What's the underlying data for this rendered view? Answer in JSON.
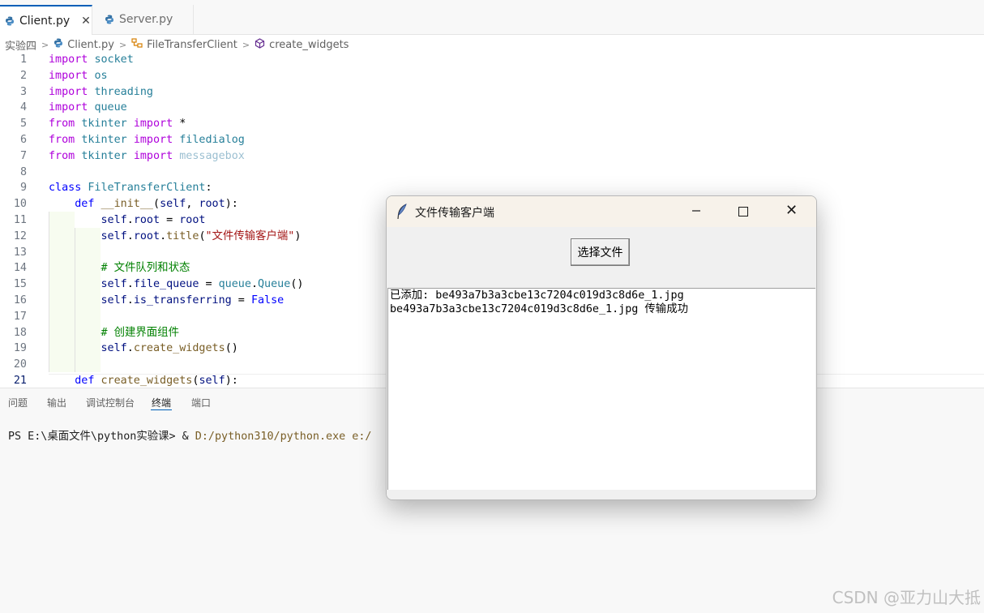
{
  "tabs": [
    {
      "label": "Client.py",
      "active": true,
      "close": "✕"
    },
    {
      "label": "Server.py",
      "active": false
    }
  ],
  "breadcrumb": [
    "实验四",
    "Client.py",
    "FileTransferClient",
    "create_widgets"
  ],
  "code": {
    "line_numbers": [
      "1",
      "2",
      "3",
      "4",
      "5",
      "6",
      "7",
      "8",
      "9",
      "10",
      "11",
      "12",
      "13",
      "14",
      "15",
      "16",
      "17",
      "18",
      "19",
      "20",
      "21"
    ],
    "lines": [
      [
        {
          "t": "import",
          "c": "kw"
        },
        {
          "t": " "
        },
        {
          "t": "socket",
          "c": "mod"
        }
      ],
      [
        {
          "t": "import",
          "c": "kw"
        },
        {
          "t": " "
        },
        {
          "t": "os",
          "c": "mod"
        }
      ],
      [
        {
          "t": "import",
          "c": "kw"
        },
        {
          "t": " "
        },
        {
          "t": "threading",
          "c": "mod"
        }
      ],
      [
        {
          "t": "import",
          "c": "kw"
        },
        {
          "t": " "
        },
        {
          "t": "queue",
          "c": "mod"
        }
      ],
      [
        {
          "t": "from",
          "c": "kw"
        },
        {
          "t": " "
        },
        {
          "t": "tkinter",
          "c": "mod"
        },
        {
          "t": " "
        },
        {
          "t": "import",
          "c": "kw"
        },
        {
          "t": " *",
          "c": "op"
        }
      ],
      [
        {
          "t": "from",
          "c": "kw"
        },
        {
          "t": " "
        },
        {
          "t": "tkinter",
          "c": "mod"
        },
        {
          "t": " "
        },
        {
          "t": "import",
          "c": "kw"
        },
        {
          "t": " "
        },
        {
          "t": "filedialog",
          "c": "mod"
        }
      ],
      [
        {
          "t": "from",
          "c": "kw"
        },
        {
          "t": " "
        },
        {
          "t": "tkinter",
          "c": "mod"
        },
        {
          "t": " "
        },
        {
          "t": "import",
          "c": "kw"
        },
        {
          "t": " "
        },
        {
          "t": "messagebox",
          "c": "fade"
        }
      ],
      [],
      [
        {
          "t": "class",
          "c": "kw2"
        },
        {
          "t": " "
        },
        {
          "t": "FileTransferClient",
          "c": "mod"
        },
        {
          "t": ":",
          "c": "op"
        }
      ],
      [
        {
          "t": "    "
        },
        {
          "t": "def",
          "c": "kw2"
        },
        {
          "t": " "
        },
        {
          "t": "__init__",
          "c": "fn"
        },
        {
          "t": "(",
          "c": "op"
        },
        {
          "t": "self",
          "c": "var"
        },
        {
          "t": ", ",
          "c": "op"
        },
        {
          "t": "root",
          "c": "var"
        },
        {
          "t": "):",
          "c": "op"
        }
      ],
      [
        {
          "t": "        "
        },
        {
          "t": "self",
          "c": "var"
        },
        {
          "t": ".",
          "c": "op"
        },
        {
          "t": "root",
          "c": "var"
        },
        {
          "t": " = ",
          "c": "op"
        },
        {
          "t": "root",
          "c": "var"
        }
      ],
      [
        {
          "t": "        "
        },
        {
          "t": "self",
          "c": "var"
        },
        {
          "t": ".",
          "c": "op"
        },
        {
          "t": "root",
          "c": "var"
        },
        {
          "t": ".",
          "c": "op"
        },
        {
          "t": "title",
          "c": "fn"
        },
        {
          "t": "(",
          "c": "op"
        },
        {
          "t": "\"文件传输客户端\"",
          "c": "str"
        },
        {
          "t": ")",
          "c": "op"
        }
      ],
      [],
      [
        {
          "t": "        "
        },
        {
          "t": "# 文件队列和状态",
          "c": "cmt"
        }
      ],
      [
        {
          "t": "        "
        },
        {
          "t": "self",
          "c": "var"
        },
        {
          "t": ".",
          "c": "op"
        },
        {
          "t": "file_queue",
          "c": "var"
        },
        {
          "t": " = ",
          "c": "op"
        },
        {
          "t": "queue",
          "c": "mod"
        },
        {
          "t": ".",
          "c": "op"
        },
        {
          "t": "Queue",
          "c": "mod"
        },
        {
          "t": "()",
          "c": "op"
        }
      ],
      [
        {
          "t": "        "
        },
        {
          "t": "self",
          "c": "var"
        },
        {
          "t": ".",
          "c": "op"
        },
        {
          "t": "is_transferring",
          "c": "var"
        },
        {
          "t": " = ",
          "c": "op"
        },
        {
          "t": "False",
          "c": "kw2"
        }
      ],
      [],
      [
        {
          "t": "        "
        },
        {
          "t": "# 创建界面组件",
          "c": "cmt"
        }
      ],
      [
        {
          "t": "        "
        },
        {
          "t": "self",
          "c": "var"
        },
        {
          "t": ".",
          "c": "op"
        },
        {
          "t": "create_widgets",
          "c": "fn"
        },
        {
          "t": "()",
          "c": "op"
        }
      ],
      [],
      [
        {
          "t": "    "
        },
        {
          "t": "def",
          "c": "kw2"
        },
        {
          "t": " "
        },
        {
          "t": "create_widgets",
          "c": "fn"
        },
        {
          "t": "(",
          "c": "op"
        },
        {
          "t": "self",
          "c": "var"
        },
        {
          "t": "):",
          "c": "op"
        }
      ]
    ]
  },
  "panel": {
    "tabs": [
      "问题",
      "输出",
      "调试控制台",
      "终端",
      "端口"
    ],
    "active_tab": "终端",
    "terminal_prompt": "PS E:\\桌面文件\\python实验课> & ",
    "terminal_path": "D:/python310/python.exe e:/"
  },
  "tk_window": {
    "title": "文件传输客户端",
    "min_icon": "—",
    "close_icon": "✕",
    "select_button": "选择文件",
    "log_lines": [
      "已添加: be493a7b3a3cbe13c7204c019d3c8d6e_1.jpg",
      "be493a7b3a3cbe13c7204c019d3c8d6e_1.jpg 传输成功"
    ]
  },
  "watermark": "CSDN @亚力山大抵"
}
